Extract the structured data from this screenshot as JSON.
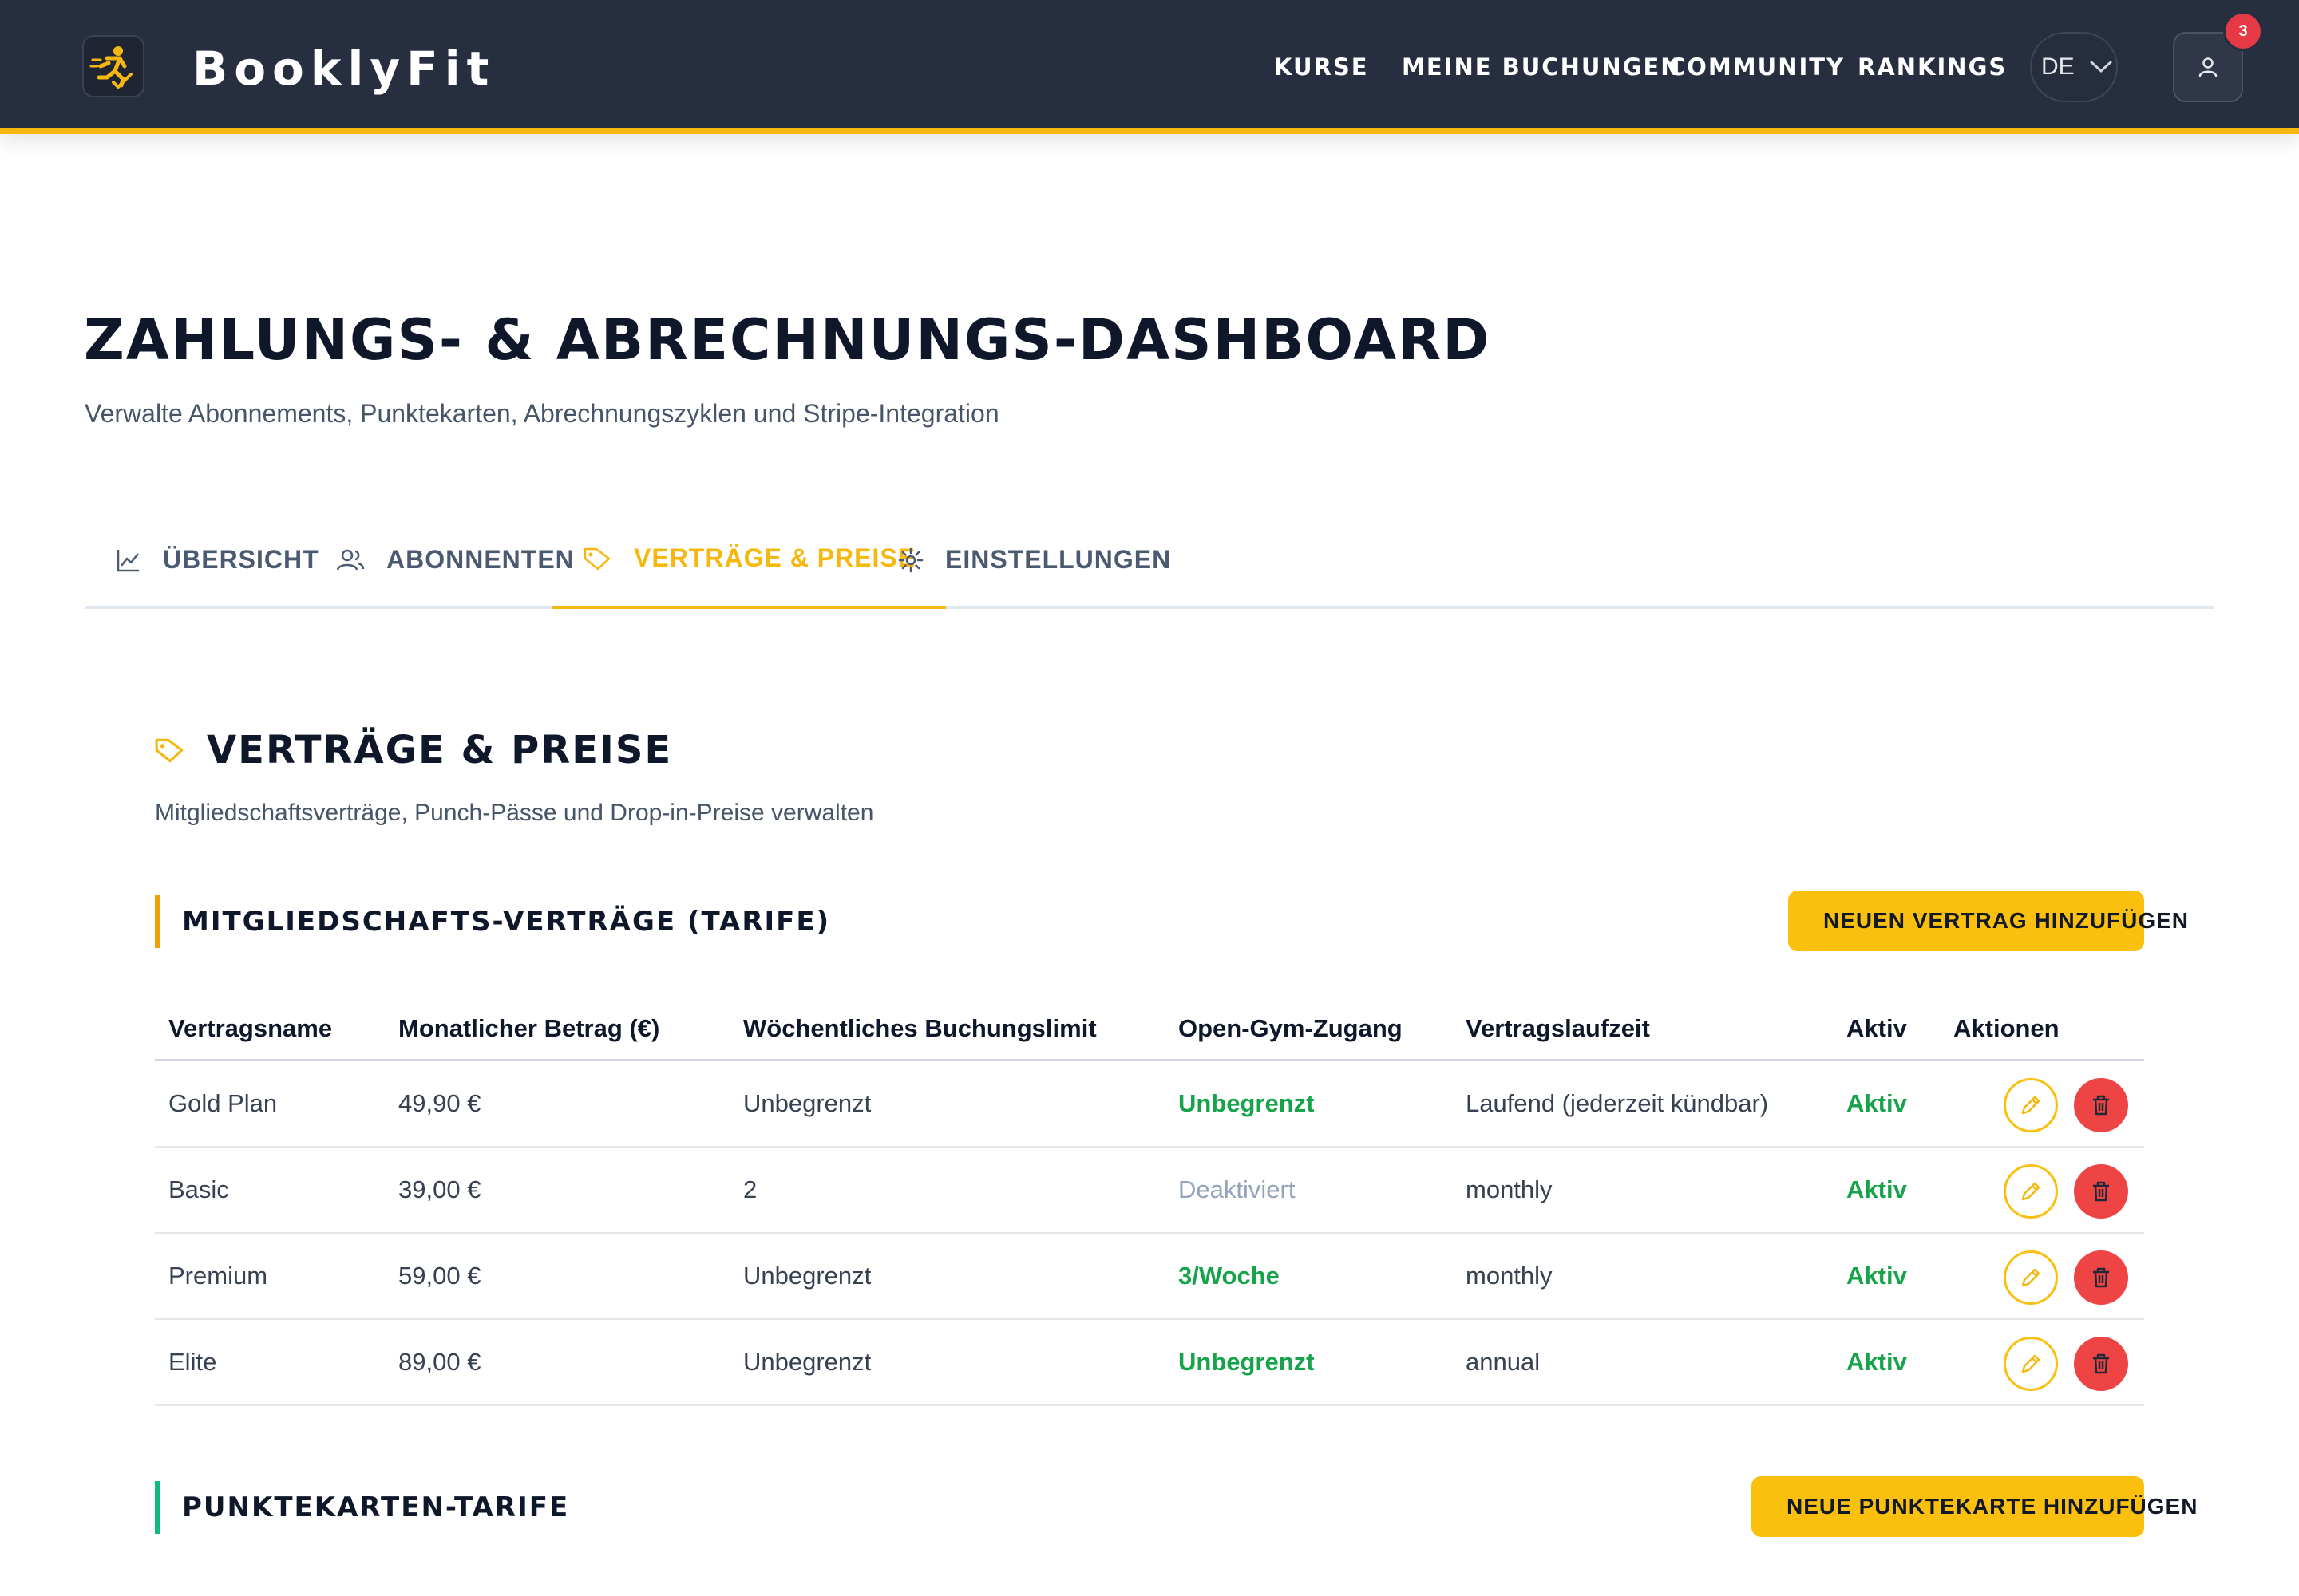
{
  "header": {
    "brand": "BooklyFit",
    "nav": [
      "KURSE",
      "MEINE BUCHUNGEN",
      "COMMUNITY",
      "RANKINGS"
    ],
    "language": "DE",
    "notification_count": "3"
  },
  "page": {
    "title": "ZAHLUNGS- & ABRECHNUNGS-DASHBOARD",
    "subtitle": "Verwalte Abonnements, Punktekarten, Abrechnungszyklen und Stripe-Integration"
  },
  "tabs": [
    {
      "label": "ÜBERSICHT",
      "icon": "chart-line-icon",
      "active": false
    },
    {
      "label": "ABONNENTEN",
      "icon": "users-icon",
      "active": false
    },
    {
      "label": "VERTRÄGE & PREISE",
      "icon": "tag-icon",
      "active": true
    },
    {
      "label": "EINSTELLUNGEN",
      "icon": "gear-icon",
      "active": false
    }
  ],
  "section": {
    "title": "VERTRÄGE & PREISE",
    "subtitle": "Mitgliedschaftsverträge, Punch-Pässe und Drop-in-Preise verwalten"
  },
  "contracts": {
    "heading": "MITGLIEDSCHAFTS-VERTRÄGE (TARIFE)",
    "add_button": "NEUEN VERTRAG HINZUFÜGEN",
    "columns": [
      "Vertragsname",
      "Monatlicher Betrag (€)",
      "Wöchentliches Buchungslimit",
      "Open-Gym-Zugang",
      "Vertragslaufzeit",
      "Aktiv",
      "Aktionen"
    ],
    "rows": [
      {
        "name": "Gold Plan",
        "amount": "49,90 €",
        "limit": "Unbegrenzt",
        "open_gym": "Unbegrenzt",
        "open_gym_state": "on",
        "term": "Laufend (jederzeit kündbar)",
        "active": "Aktiv"
      },
      {
        "name": "Basic",
        "amount": "39,00 €",
        "limit": "2",
        "open_gym": "Deaktiviert",
        "open_gym_state": "off",
        "term": "monthly",
        "active": "Aktiv"
      },
      {
        "name": "Premium",
        "amount": "59,00 €",
        "limit": "Unbegrenzt",
        "open_gym": "3/Woche",
        "open_gym_state": "on",
        "term": "monthly",
        "active": "Aktiv"
      },
      {
        "name": "Elite",
        "amount": "89,00 €",
        "limit": "Unbegrenzt",
        "open_gym": "Unbegrenzt",
        "open_gym_state": "on",
        "term": "annual",
        "active": "Aktiv"
      }
    ]
  },
  "punchcards": {
    "heading": "PUNKTEKARTEN-TARIFE",
    "add_button": "NEUE PUNKTEKARTE HINZUFÜGEN"
  },
  "colors": {
    "accent": "#f6b80f",
    "header_bg": "#272e3f",
    "success": "#16a34a",
    "danger": "#ef4444"
  }
}
